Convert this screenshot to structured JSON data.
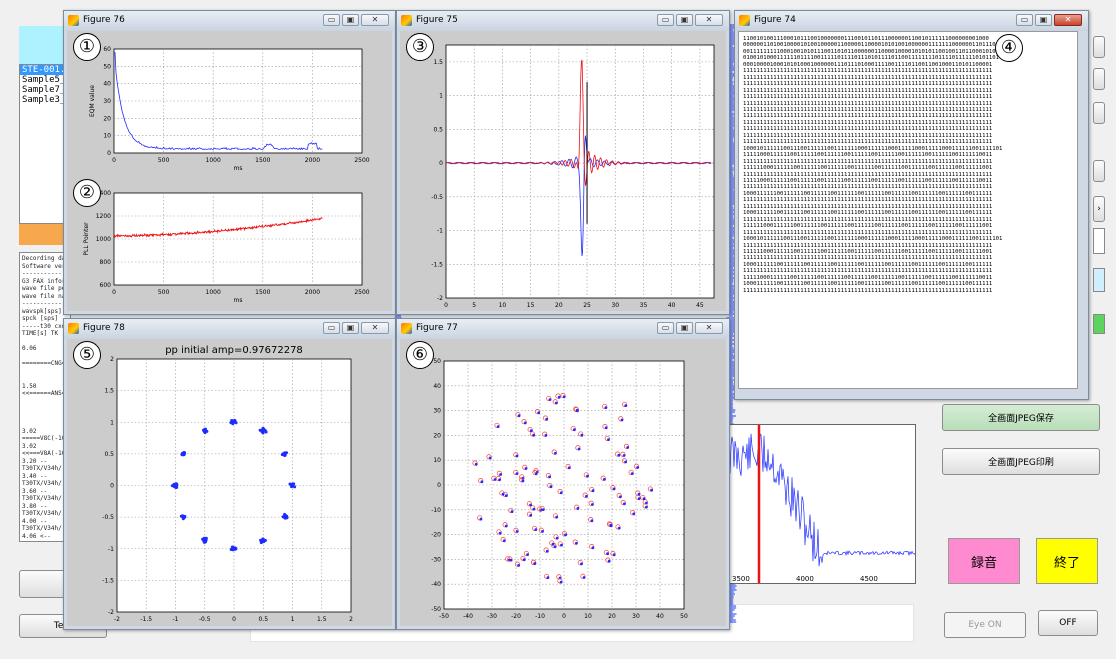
{
  "figures": {
    "fig76": {
      "title": "Figure 76",
      "num": "①",
      "num2": "②",
      "eqm": {
        "ylabel": "EQM value",
        "xlabel": "ms",
        "xticks": [
          "0",
          "500",
          "1000",
          "1500",
          "2000",
          "2500"
        ],
        "yticks": [
          "0",
          "10",
          "20",
          "30",
          "40",
          "50",
          "60"
        ]
      },
      "pll": {
        "ylabel": "PLL Pointer",
        "xlabel": "ms",
        "xticks": [
          "0",
          "500",
          "1000",
          "1500",
          "2000",
          "2500"
        ],
        "yticks": [
          "600",
          "800",
          "1000",
          "1200",
          "1400"
        ]
      }
    },
    "fig75": {
      "title": "Figure 75",
      "num": "③",
      "xticks": [
        "0",
        "5",
        "10",
        "15",
        "20",
        "25",
        "30",
        "35",
        "40",
        "45"
      ],
      "yticks": [
        "-2",
        "-1.5",
        "-1",
        "-0.5",
        "0",
        "0.5",
        "1",
        "1.5"
      ]
    },
    "fig74": {
      "title": "Figure 74",
      "num": "④"
    },
    "fig78": {
      "title": "Figure 78",
      "num": "⑤",
      "plot_title": "pp initial amp=0.97672278",
      "xticks": [
        "-2",
        "-1.5",
        "-1",
        "-0.5",
        "0",
        "0.5",
        "1",
        "1.5",
        "2"
      ],
      "yticks": [
        "-2",
        "-1.5",
        "-1",
        "-0.5",
        "0",
        "0.5",
        "1",
        "1.5",
        "2"
      ]
    },
    "fig77": {
      "title": "Figure 77",
      "num": "⑥",
      "xticks": [
        "-50",
        "-40",
        "-30",
        "-20",
        "-10",
        "0",
        "10",
        "20",
        "30",
        "40",
        "50"
      ],
      "yticks": [
        "-50",
        "-40",
        "-30",
        "-20",
        "-10",
        "0",
        "10",
        "20",
        "30",
        "40",
        "50"
      ]
    }
  },
  "bits_text": "1100101001110001011100100000001110010110111000000110010111111000000001000\n000000110100100001010010000011000001100001010100100000011111110000001101110100110\n00111111111000100101011100110101100000011000010000101010110010011011000101001\n0100101000111111011110011111011110111010111101100111111110111101111110101101\n00010000100010101000100000011101110100011110011110110011001000110101100001\n11111111111111111111111111111111111111111111111111111111111111111111111111\n11111111111111111111111111111111111111111111111111111111111111111111111111\n11111111111111111111111111111111111111111111111111111111111111111111111111\n11111111111111111111111111111111111111111111111111111111111111111111111111\n11111111111111111111111111111111111111111111111111111111111111111111111111\n11111111111111111111111111111111111111111111111111111111111111111111111111\n11111111111111111111111111111111111111111111111111111111111111111111111111\n11111111111111111111111111111111111111111111111111111111111111111111111111\n11111111111111111111111111111111111111111111111111111111111111111111111111\n11111111111111111111111111111111111111111111111111111111111111111111111111\n11111111111111111111111111111111111111111111111111111111111111111111111111\n11111111111111111111111111111111111111111111111111111111111111111111111111\n10001011111100111001111110011111110001111110001111100011111000111111001111101\n11111000111111001111110011111100111111001111110011111100111111001111110011\n11111111111111111111111111111111111111111111111111111111111111111111111111\n11111100011111100111111001111110011111100111111001111110011111100111111001\n11111111111111111111111111111111111111111111111111111111111111111111111111\n11111000111111001111110011111100111111001111110011111100111111001111110011\n11111111111111111111111111111111111111111111111111111111111111111111111111\n10001111110011111100111111001111110011111100111111001111110011111100111111\n11111111111111111111111111111111111111111111111111111111111111111111111111\n11111111111111111111111111111111111111111111111111111111111111111111111111\n10001111110011111100111111001111110011111100111111001111110011111100111111\n11111111111111111111111111111111111111111111111111111111111111111111111111\n11111100011111100111111001111110011111100111111001111110011111100111111001\n11111111111111111111111111111111111111111111111111111111111111111111111111\n10001011111100111001111110011111110001111110001111100011111000111111001111101\n11111111111111111111111111111111111111111111111111111111111111111111111111\n11111100011111100111111001111110011111100111111001111110011111100111111001\n11111111111111111111111111111111111111111111111111111111111111111111111111\n10001111110011111100111111001111110011111100111111001111110011111100111111\n11111111111111111111111111111111111111111111111111111111111111111111111111\n11111000111111001111110011111100111111001111110011111100111111001111110011\n10001111110011111100111111001111110011111100111111001111110011111100111111\n11111111111111111111111111111111111111111111111111111111111111111111111111",
  "app": {
    "list_items": [
      "STE-001.w",
      "Sample5_v",
      "Sample7_v",
      "Sample3_v"
    ],
    "log_lines": [
      "Decording da",
      "Software ver",
      "-----------",
      "G3 FAX infor",
      "wave file pe",
      "wave file na",
      "-----------",
      "wavspk[sps]",
      "spck  [sps]",
      "-----t30 cxd",
      "TIME[s] TK",
      "",
      "0.06",
      "",
      "========CNG=",
      "",
      "",
      "1.50",
      "<<======ANS=",
      "",
      "",
      "",
      "",
      "3.02",
      "=====V8C(-10",
      "3.02",
      "<<===V8A(-10",
      "3.20     --",
      "T30TX/V34h/",
      "3.40     --",
      "T30TX/V34h/",
      "3.60     --",
      "T30TX/V34h/",
      "3.80     --",
      "T30TX/V34h/",
      "4.00     --",
      "T30TX/V34h/",
      "4.06     <--"
    ],
    "buttons": {
      "save_jpeg": "全画面JPEG保存",
      "print_jpeg": "全画面JPEG印刷",
      "record": "録音",
      "quit": "終了",
      "eye_on": "Eye ON",
      "off": "OFF",
      "text": "Text"
    },
    "bg_title": "STE-001.wav",
    "spectrum_ticks": [
      "3500",
      "4000",
      "4500"
    ]
  }
}
